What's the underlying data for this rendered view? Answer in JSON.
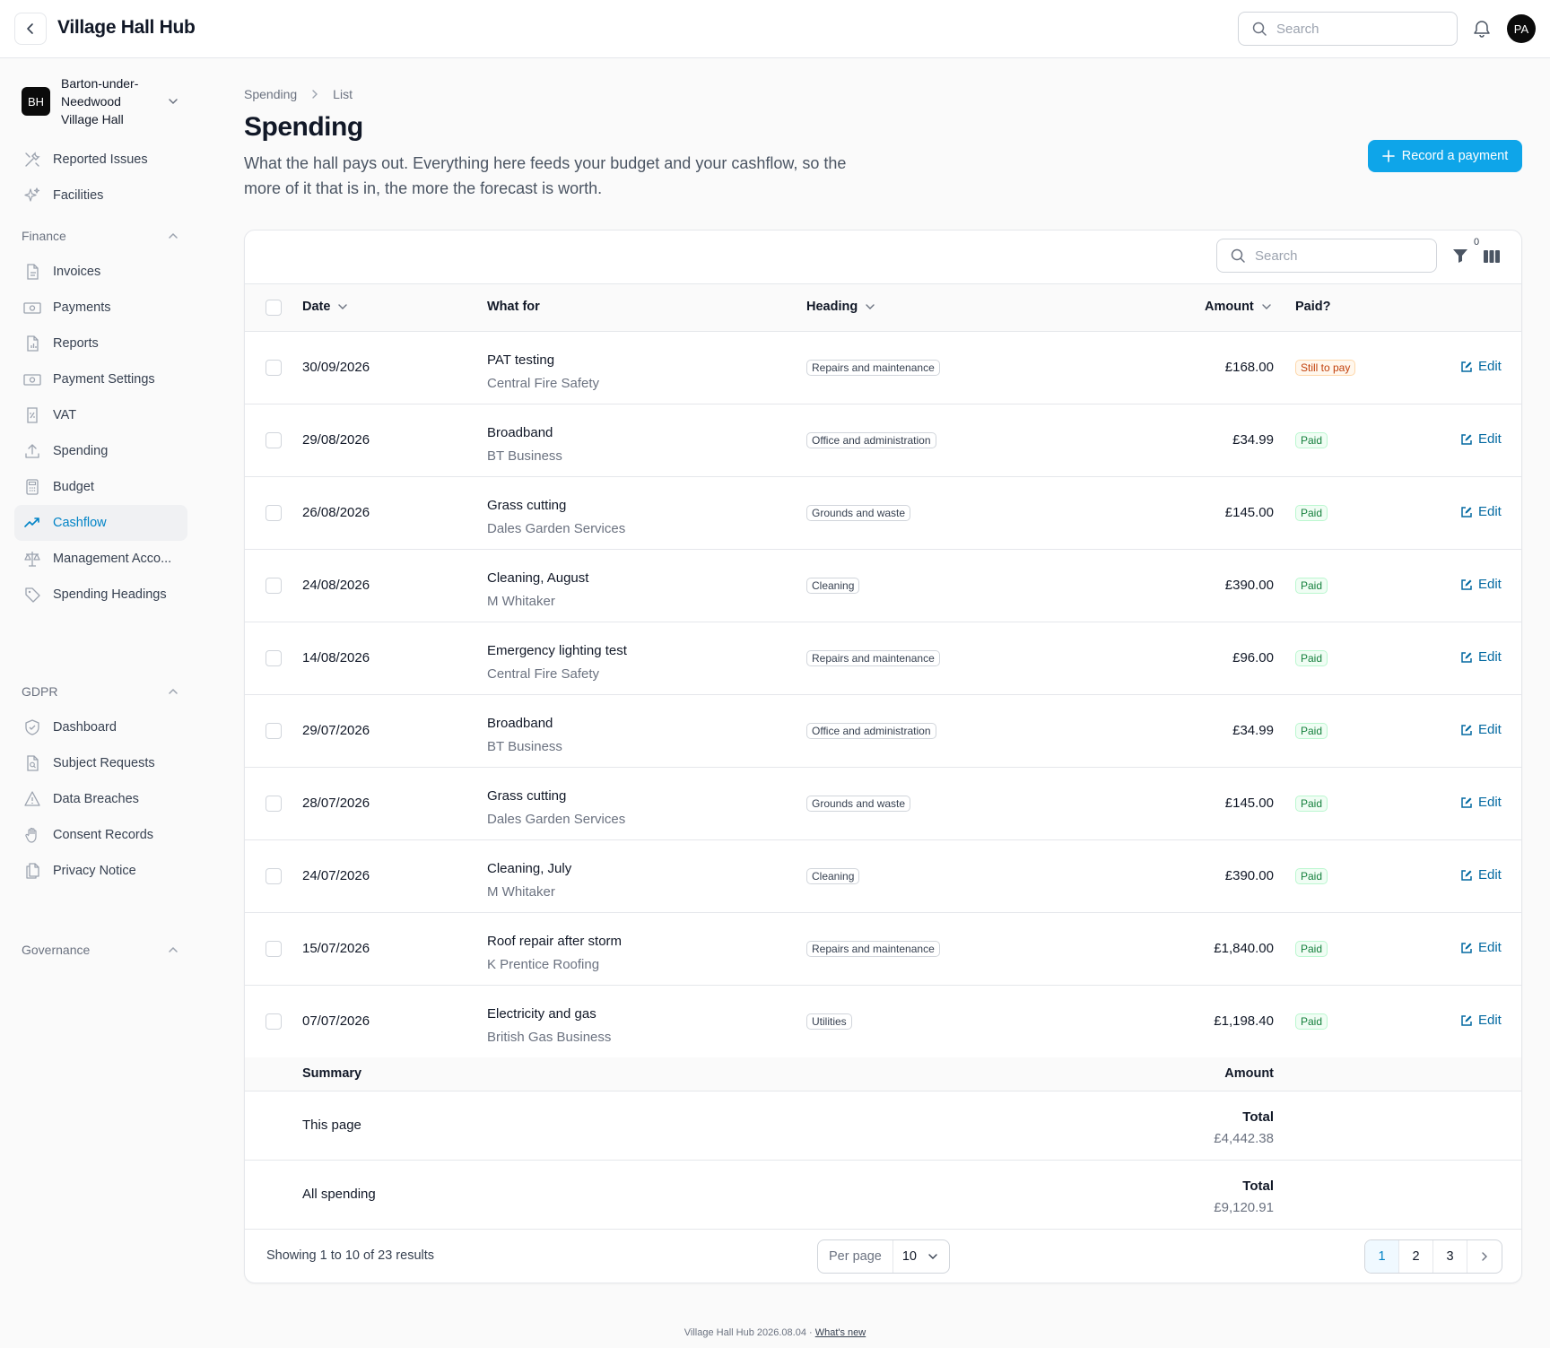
{
  "header": {
    "title": "Village Hall Hub",
    "search_placeholder": "Search",
    "avatar": "PA"
  },
  "sidebar": {
    "org_initials": "BH",
    "org_name": "Barton-under-Needwood Village Hall",
    "top_items": [
      {
        "label": "Reported Issues",
        "icon": "tools-icon"
      },
      {
        "label": "Facilities",
        "icon": "sparkles-icon"
      }
    ],
    "finance": {
      "title": "Finance",
      "items": [
        {
          "label": "Invoices",
          "icon": "document-icon"
        },
        {
          "label": "Payments",
          "icon": "banknote-icon"
        },
        {
          "label": "Reports",
          "icon": "report-icon"
        },
        {
          "label": "Payment Settings",
          "icon": "banknote-icon"
        },
        {
          "label": "VAT",
          "icon": "receipt-percent-icon"
        },
        {
          "label": "Spending",
          "icon": "upload-icon"
        },
        {
          "label": "Budget",
          "icon": "calculator-icon"
        },
        {
          "label": "Cashflow",
          "icon": "trending-up-icon"
        },
        {
          "label": "Management Acco...",
          "icon": "scale-icon"
        },
        {
          "label": "Spending Headings",
          "icon": "tag-icon"
        }
      ]
    },
    "gdpr": {
      "title": "GDPR",
      "items": [
        {
          "label": "Dashboard",
          "icon": "shield-check-icon"
        },
        {
          "label": "Subject Requests",
          "icon": "document-search-icon"
        },
        {
          "label": "Data Breaches",
          "icon": "warning-icon"
        },
        {
          "label": "Consent Records",
          "icon": "hand-icon"
        },
        {
          "label": "Privacy Notice",
          "icon": "documents-icon"
        }
      ]
    },
    "governance": {
      "title": "Governance"
    }
  },
  "page": {
    "breadcrumb": [
      "Spending",
      "List"
    ],
    "title": "Spending",
    "description": "What the hall pays out. Everything here feeds your budget and your cashflow, so the more of it that is in, the more the forecast is worth.",
    "record_button": "Record a payment"
  },
  "table": {
    "search_placeholder": "Search",
    "filter_count": "0",
    "columns": {
      "date": "Date",
      "what": "What for",
      "heading": "Heading",
      "amount": "Amount",
      "paid": "Paid?"
    },
    "edit_label": "Edit",
    "rows": [
      {
        "date": "30/09/2026",
        "what": "PAT testing",
        "who": "Central Fire Safety",
        "heading": "Repairs and maintenance",
        "amount": "£168.00",
        "paid": "Still to pay",
        "is_paid": false
      },
      {
        "date": "29/08/2026",
        "what": "Broadband",
        "who": "BT Business",
        "heading": "Office and administration",
        "amount": "£34.99",
        "paid": "Paid",
        "is_paid": true
      },
      {
        "date": "26/08/2026",
        "what": "Grass cutting",
        "who": "Dales Garden Services",
        "heading": "Grounds and waste",
        "amount": "£145.00",
        "paid": "Paid",
        "is_paid": true
      },
      {
        "date": "24/08/2026",
        "what": "Cleaning, August",
        "who": "M Whitaker",
        "heading": "Cleaning",
        "amount": "£390.00",
        "paid": "Paid",
        "is_paid": true
      },
      {
        "date": "14/08/2026",
        "what": "Emergency lighting test",
        "who": "Central Fire Safety",
        "heading": "Repairs and maintenance",
        "amount": "£96.00",
        "paid": "Paid",
        "is_paid": true
      },
      {
        "date": "29/07/2026",
        "what": "Broadband",
        "who": "BT Business",
        "heading": "Office and administration",
        "amount": "£34.99",
        "paid": "Paid",
        "is_paid": true
      },
      {
        "date": "28/07/2026",
        "what": "Grass cutting",
        "who": "Dales Garden Services",
        "heading": "Grounds and waste",
        "amount": "£145.00",
        "paid": "Paid",
        "is_paid": true
      },
      {
        "date": "24/07/2026",
        "what": "Cleaning, July",
        "who": "M Whitaker",
        "heading": "Cleaning",
        "amount": "£390.00",
        "paid": "Paid",
        "is_paid": true
      },
      {
        "date": "15/07/2026",
        "what": "Roof repair after storm",
        "who": "K Prentice Roofing",
        "heading": "Repairs and maintenance",
        "amount": "£1,840.00",
        "paid": "Paid",
        "is_paid": true
      },
      {
        "date": "07/07/2026",
        "what": "Electricity and gas",
        "who": "British Gas Business",
        "heading": "Utilities",
        "amount": "£1,198.40",
        "paid": "Paid",
        "is_paid": true
      }
    ],
    "summary": {
      "label": "Summary",
      "amount_label": "Amount",
      "this_page": {
        "label": "This page",
        "total_label": "Total",
        "total": "£4,442.38"
      },
      "all": {
        "label": "All spending",
        "total_label": "Total",
        "total": "£9,120.91"
      }
    },
    "footer": {
      "showing": "Showing 1 to 10 of 23 results",
      "per_page_label": "Per page",
      "per_page_value": "10",
      "pages": [
        "1",
        "2",
        "3"
      ],
      "current_page": "1"
    }
  },
  "footer": {
    "version": "Village Hall Hub 2026.08.04 · ",
    "whats_new": "What's new"
  },
  "colors": {
    "accent": "#0ea5e9",
    "link": "#0369a1",
    "paid": "#15803d",
    "unpaid": "#c2410c"
  }
}
